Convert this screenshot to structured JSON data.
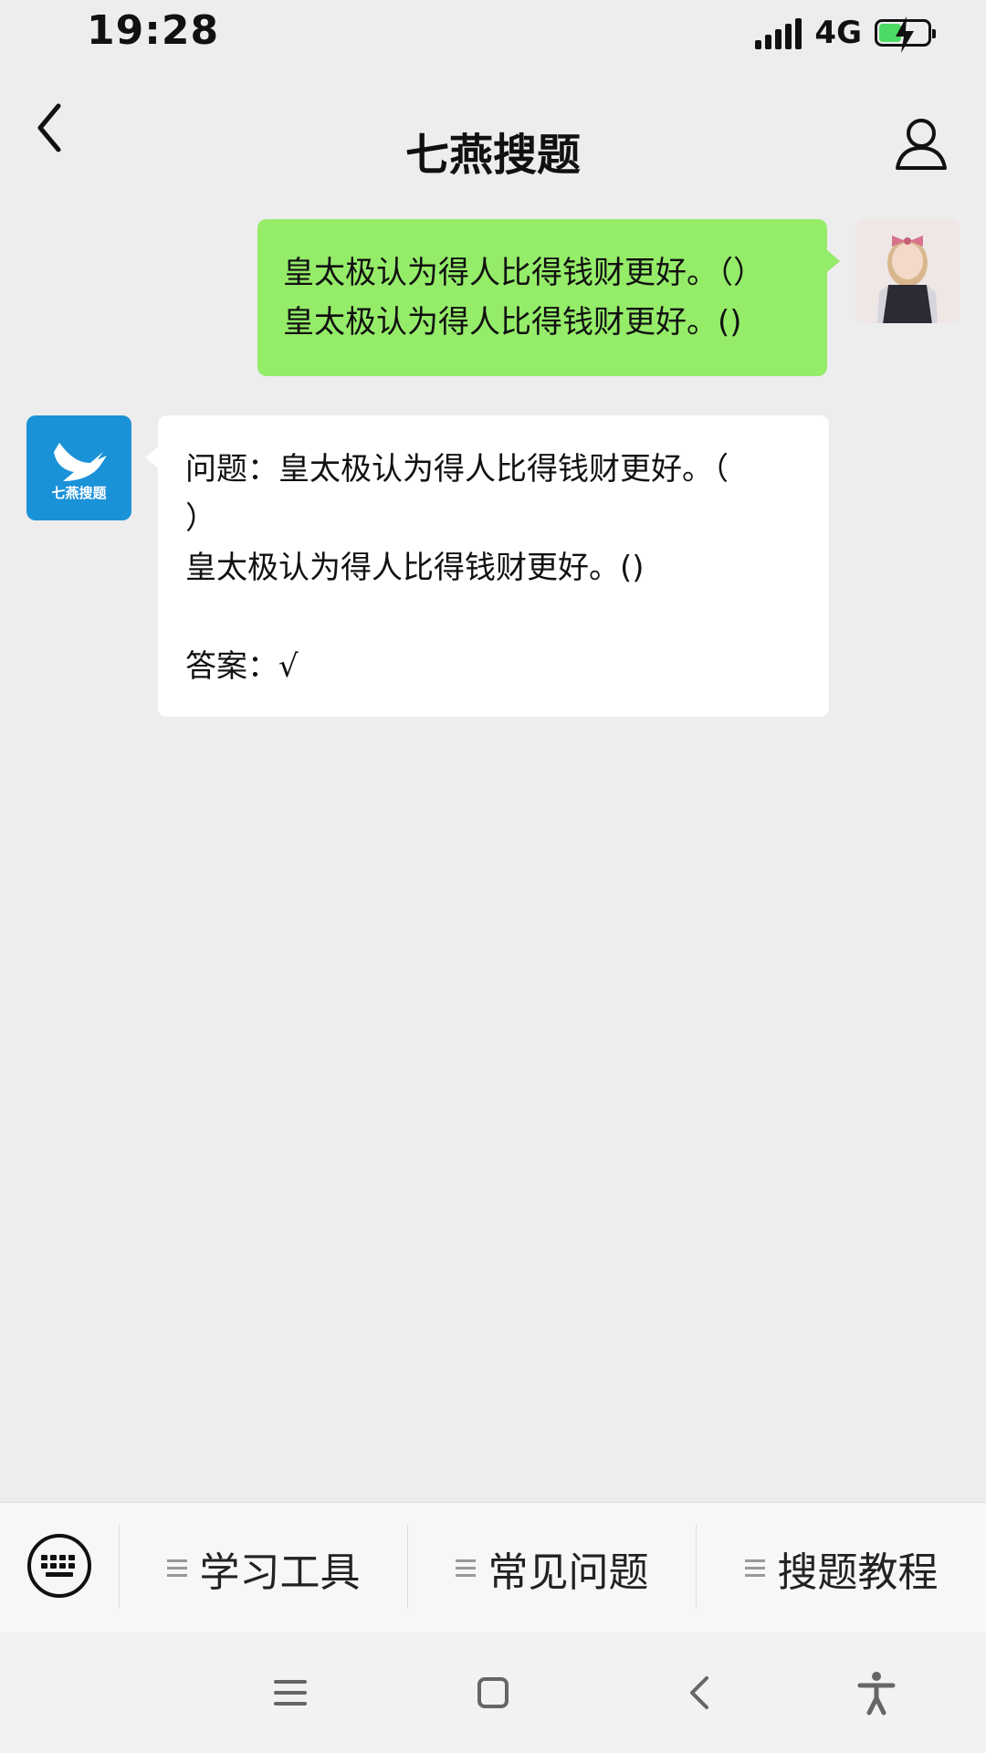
{
  "status_bar": {
    "time": "19:28",
    "network": "4G",
    "battery_level": 0.4,
    "battery_color": "#4cd964"
  },
  "nav": {
    "title": "七燕搜题",
    "back_icon": "chevron-left-icon",
    "profile_icon": "person-icon"
  },
  "conversation": {
    "sent": {
      "lines": [
        "皇太极认为得人比得钱财更好。（）",
        "皇太极认为得人比得钱财更好。()"
      ],
      "bubble_color": "#95ec69"
    },
    "received": {
      "avatar_label": "七燕搜题",
      "avatar_color": "#1a92d8",
      "question_lines": [
        "问题：皇太极认为得人比得钱财更好。（",
        "）",
        "皇太极认为得人比得钱财更好。()"
      ],
      "answer": "答案：√"
    }
  },
  "bottom_menu": {
    "keyboard_icon": "keyboard-icon",
    "items": [
      {
        "label": "学习工具",
        "icon": "menu-icon"
      },
      {
        "label": "常见问题",
        "icon": "menu-icon"
      },
      {
        "label": "搜题教程",
        "icon": "menu-icon"
      }
    ]
  },
  "system_nav": {
    "icons": [
      "menu-icon",
      "home-icon",
      "back-icon",
      "accessibility-icon"
    ]
  }
}
